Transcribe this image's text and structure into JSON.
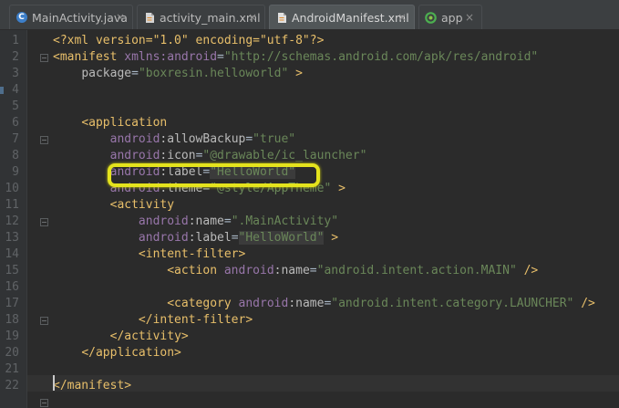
{
  "tabs": [
    {
      "label": "MainActivity.java",
      "icon": "class-c-icon",
      "active": false
    },
    {
      "label": "activity_main.xml",
      "icon": "xml-file-icon",
      "active": false
    },
    {
      "label": "AndroidManifest.xml",
      "icon": "manifest-file-icon",
      "active": true
    },
    {
      "label": "app",
      "icon": "android-module-icon",
      "active": false
    }
  ],
  "close_glyph": "×",
  "class_badge_letter": "C",
  "line_numbers": [
    "1",
    "2",
    "3",
    "4",
    "5",
    "6",
    "7",
    "8",
    "9",
    "10",
    "11",
    "12",
    "13",
    "14",
    "15",
    "16",
    "17",
    "18",
    "19",
    "20",
    "21",
    "22"
  ],
  "code": {
    "l1": {
      "a": "<?xml version=\"1.0\" encoding=\"utf-8\"?>"
    },
    "l2": {
      "tag": "<manifest",
      "ns": "xmlns:android",
      "eq": "=",
      "val": "\"http://schemas.android.com/apk/res/android\""
    },
    "l3": {
      "attr": "package",
      "eq": "=",
      "val": "\"boxresin.helloworld\"",
      "end": " >"
    },
    "l5": {
      "tag": "<application"
    },
    "l6": {
      "ns": "android",
      "attr": ":allowBackup",
      "eq": "=",
      "val": "\"true\""
    },
    "l7": {
      "ns": "android",
      "attr": ":icon",
      "eq": "=",
      "val": "\"@drawable/ic_launcher\""
    },
    "l8": {
      "ns": "android",
      "attr": ":label",
      "eq": "=",
      "val": "\"HelloWorld\""
    },
    "l9": {
      "ns": "android",
      "attr": ":theme",
      "eq": "=",
      "val": "\"@style/AppTheme\"",
      "end": " >"
    },
    "l10": {
      "tag": "<activity"
    },
    "l11": {
      "ns": "android",
      "attr": ":name",
      "eq": "=",
      "val": "\".MainActivity\""
    },
    "l12": {
      "ns": "android",
      "attr": ":label",
      "eq": "=",
      "val": "\"HelloWorld\"",
      "end": " >"
    },
    "l13": {
      "tag": "<intent-filter>"
    },
    "l14": {
      "tag": "<action",
      "ns": " android",
      "attr": ":name",
      "eq": "=",
      "val": "\"android.intent.action.MAIN\"",
      "end": " />"
    },
    "l16": {
      "tag": "<category",
      "ns": " android",
      "attr": ":name",
      "eq": "=",
      "val": "\"android.intent.category.LAUNCHER\"",
      "end": " />"
    },
    "l17": {
      "tag": "</intent-filter>"
    },
    "l18": {
      "tag": "</activity>"
    },
    "l19": {
      "tag": "</application>"
    },
    "l21": {
      "tag": "</manifest>"
    }
  },
  "colors": {
    "background": "#2b2b2b",
    "tag": "#e8bf6a",
    "namespace": "#9876aa",
    "attribute": "#bababa",
    "value": "#6a8759",
    "highlight_box": "#e4e31d"
  }
}
